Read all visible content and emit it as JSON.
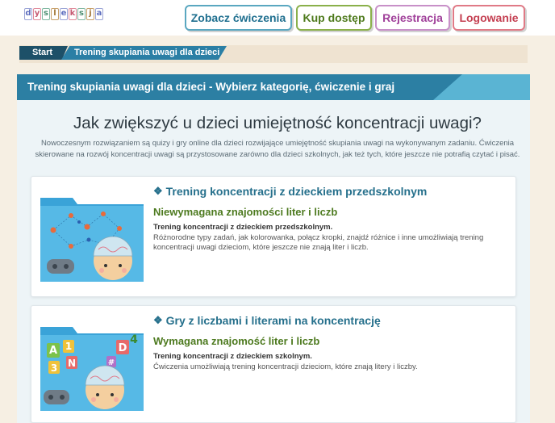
{
  "logo": {
    "letters": [
      "d",
      "y",
      "s",
      "l",
      "e",
      "k",
      "s",
      "j",
      "a"
    ]
  },
  "nav": {
    "exercises": "Zobacz ćwiczenia",
    "buy": "Kup dostęp",
    "register": "Rejestracja",
    "login": "Logowanie"
  },
  "breadcrumb": {
    "start": "Start",
    "current": "Trening skupiania uwagi dla dzieci"
  },
  "banner": {
    "title": "Trening skupiania uwagi dla dzieci - Wybierz kategorię, ćwiczenie i graj"
  },
  "main": {
    "heading": "Jak zwiększyć u dzieci umiejętność koncentracji uwagi?",
    "intro": "Nowoczesnym rozwiązaniem są quizy i gry online dla dzieci rozwijające umiejętność skupiania uwagi na wykonywanym zadaniu. Ćwiczenia skierowane na rozwój koncentracji uwagi są przystosowane zarówno dla dzieci szkolnych, jak też tych, które jeszcze nie potrafią czytać i pisać."
  },
  "cards": [
    {
      "title": "Trening koncentracji z dzieckiem przedszkolnym",
      "subtitle": "Niewymagana znajomości liter i liczb",
      "bold": "Trening koncentracji z dzieckiem przedszkolnym.",
      "desc": "Różnorodne typy zadań, jak kolorowanka, połącz kropki, znajdź różnice i inne umożliwiają trening koncentracji uwagi dzieciom, które jeszcze nie znają liter i liczb."
    },
    {
      "title": "Gry z liczbami i literami na koncentrację",
      "subtitle": "Wymagana znajomość liter i liczb",
      "bold": "Trening koncentracji z dzieckiem szkolnym.",
      "desc": "Ćwiczenia umożliwiają trening koncentracji dzieciom, które znają litery i liczby.",
      "thumb_letters": [
        "A",
        "1",
        "D",
        "4",
        "N",
        "3",
        "#"
      ]
    }
  ],
  "icons": {
    "category": "cubes-icon"
  },
  "colors": {
    "primary": "#2c7fa3",
    "dark": "#1d5068",
    "green": "#4d7a1f",
    "background": "#f6efe3"
  }
}
